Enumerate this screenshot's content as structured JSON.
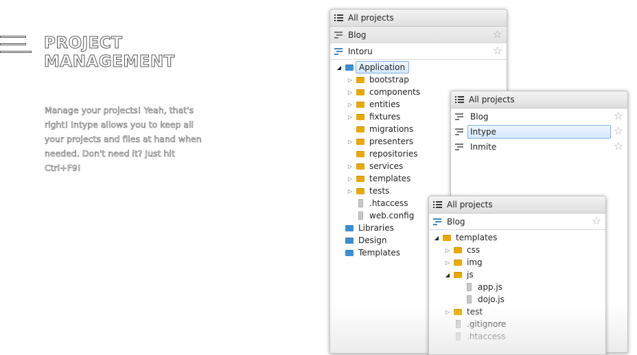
{
  "hero": {
    "title_line1": "PROJECT",
    "title_line2": "MANAGEMENT",
    "description": "Manage your projects! Yeah, that's right! Intype allows you to keep all your projects and files at hand when needed. Don't need it? Just hit Ctrl+F9!"
  },
  "panel_main": {
    "header": "All projects",
    "projects": [
      {
        "label": "Blog"
      },
      {
        "label": "Intoru"
      }
    ],
    "tree": [
      {
        "label": "Application",
        "depth": 0,
        "kind": "folder-blue",
        "arrow": "down",
        "selected": true
      },
      {
        "label": "bootstrap",
        "depth": 1,
        "kind": "folder",
        "arrow": "right"
      },
      {
        "label": "components",
        "depth": 1,
        "kind": "folder",
        "arrow": "right"
      },
      {
        "label": "entities",
        "depth": 1,
        "kind": "folder",
        "arrow": "right"
      },
      {
        "label": "fixtures",
        "depth": 1,
        "kind": "folder",
        "arrow": "right"
      },
      {
        "label": "migrations",
        "depth": 1,
        "kind": "folder",
        "arrow": "none"
      },
      {
        "label": "presenters",
        "depth": 1,
        "kind": "folder",
        "arrow": "right"
      },
      {
        "label": "repositories",
        "depth": 1,
        "kind": "folder",
        "arrow": "none"
      },
      {
        "label": "services",
        "depth": 1,
        "kind": "folder",
        "arrow": "right"
      },
      {
        "label": "templates",
        "depth": 1,
        "kind": "folder",
        "arrow": "right"
      },
      {
        "label": "tests",
        "depth": 1,
        "kind": "folder",
        "arrow": "right"
      },
      {
        "label": ".htaccess",
        "depth": 1,
        "kind": "file",
        "arrow": "none"
      },
      {
        "label": "web.config",
        "depth": 1,
        "kind": "file",
        "arrow": "none"
      },
      {
        "label": "Libraries",
        "depth": 0,
        "kind": "folder-blue",
        "arrow": "none"
      },
      {
        "label": "Design",
        "depth": 0,
        "kind": "folder-blue",
        "arrow": "none"
      },
      {
        "label": "Templates",
        "depth": 0,
        "kind": "folder-blue",
        "arrow": "none"
      }
    ]
  },
  "panel_projects": {
    "header": "All projects",
    "projects": [
      {
        "label": "Blog"
      },
      {
        "label": "Intype"
      },
      {
        "label": "Inmite"
      }
    ]
  },
  "panel_blog": {
    "header": "All projects",
    "project": "Blog",
    "tree": [
      {
        "label": "templates",
        "depth": 0,
        "kind": "folder",
        "arrow": "down"
      },
      {
        "label": "css",
        "depth": 1,
        "kind": "folder",
        "arrow": "right"
      },
      {
        "label": "img",
        "depth": 1,
        "kind": "folder",
        "arrow": "right"
      },
      {
        "label": "js",
        "depth": 1,
        "kind": "folder",
        "arrow": "down"
      },
      {
        "label": "app.js",
        "depth": 2,
        "kind": "file",
        "arrow": "none"
      },
      {
        "label": "dojo.js",
        "depth": 2,
        "kind": "file",
        "arrow": "none"
      },
      {
        "label": "test",
        "depth": 1,
        "kind": "folder",
        "arrow": "right"
      },
      {
        "label": ".gitignore",
        "depth": 1,
        "kind": "file",
        "arrow": "none"
      },
      {
        "label": ".htaccess",
        "depth": 1,
        "kind": "file",
        "arrow": "none"
      }
    ]
  },
  "icons": {
    "list": "list-icon",
    "project": "project-icon",
    "star": "star-icon",
    "folder": "folder-icon",
    "file": "file-icon",
    "expand": "expand-arrow-icon",
    "collapse": "collapse-arrow-icon"
  },
  "colors": {
    "folder": "#e8a900",
    "folder_blue": "#3a8fd6",
    "selection": "#d5e8fb",
    "project_active": "#3a86c8"
  }
}
